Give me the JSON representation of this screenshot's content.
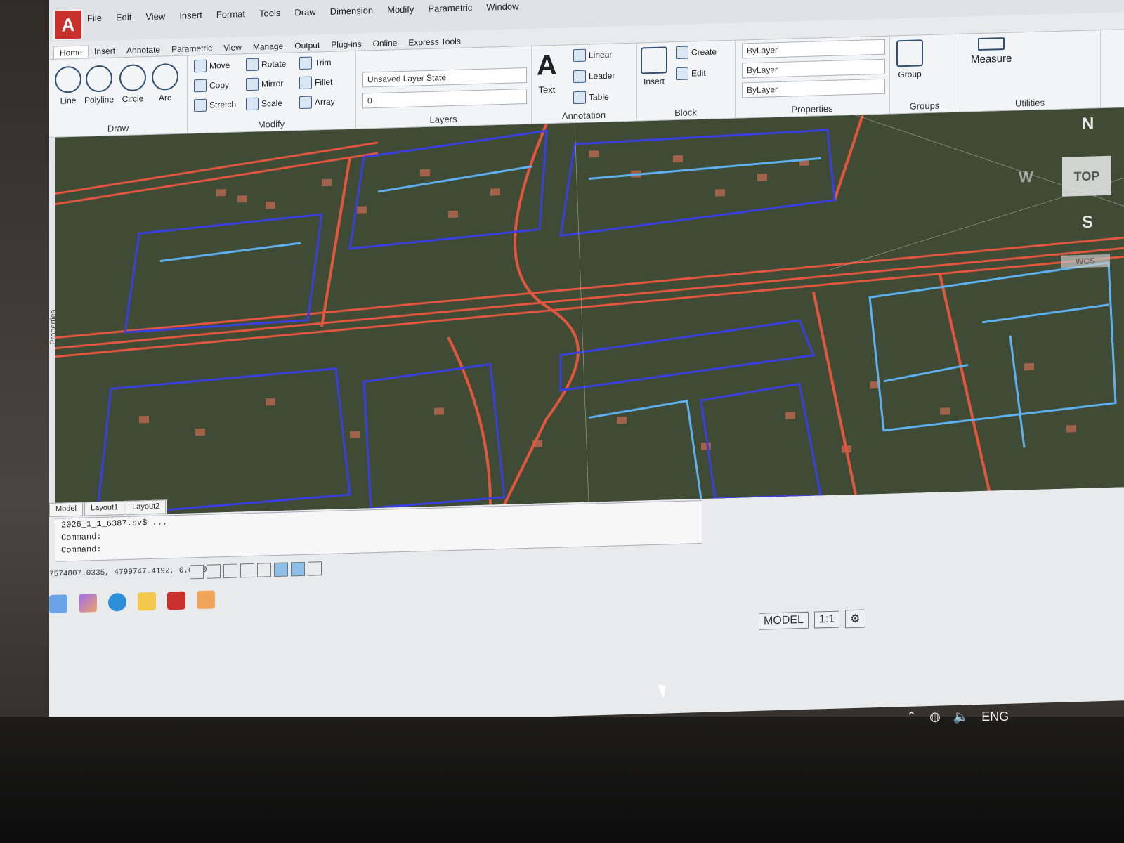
{
  "app": {
    "logo": "A",
    "file": "2026_1_1_6387.sv$ ..."
  },
  "menu": [
    "File",
    "Edit",
    "View",
    "Insert",
    "Format",
    "Tools",
    "Draw",
    "Dimension",
    "Modify",
    "Parametric",
    "Window"
  ],
  "menu2": [
    "Parametric",
    "View",
    "Manage",
    "Output",
    "Plug-ins",
    "Online",
    "Express Tools"
  ],
  "ribbon_tabs": [
    "Home",
    "Insert",
    "Annotate",
    "Parametric",
    "View",
    "Manage",
    "Output",
    "Plug-ins",
    "Online",
    "Express Tools"
  ],
  "draw": {
    "title": "Draw",
    "tools": [
      "Line",
      "Polyline",
      "Circle",
      "Arc"
    ]
  },
  "modify": {
    "title": "Modify",
    "tools": [
      "Move",
      "Rotate",
      "Trim",
      "Copy",
      "Mirror",
      "Fillet",
      "Stretch",
      "Scale",
      "Array"
    ]
  },
  "layers": {
    "title": "Layers",
    "layer_state": "Unsaved Layer State",
    "current_layer": "0"
  },
  "annotation": {
    "title": "Annotation",
    "text": "Text",
    "linear": "Linear",
    "leader": "Leader",
    "table": "Table"
  },
  "block": {
    "title": "Block",
    "insert": "Insert",
    "create": "Create",
    "edit": "Edit"
  },
  "properties": {
    "title": "Properties",
    "color": "ByLayer",
    "linetype": "ByLayer",
    "lineweight": "ByLayer"
  },
  "groups": {
    "title": "Groups",
    "group": "Group"
  },
  "utilities": {
    "title": "Utilities",
    "measure": "Measure"
  },
  "viewcube": {
    "n": "N",
    "top": "TOP",
    "w": "W",
    "s": "S",
    "wcs": "WCS"
  },
  "side_panel": "Properties",
  "layout_tabs": [
    "Model",
    "Layout1",
    "Layout2"
  ],
  "command": {
    "history": "2026_1_1_6387.sv$ ...",
    "line1": "Command:",
    "line2": "Command:"
  },
  "coords": "7574807.0335, 4799747.4192, 0.0000",
  "status": {
    "model": "MODEL",
    "scale": "1:1"
  },
  "systray": {
    "lang": "ENG"
  },
  "colors": {
    "road_red": "#e0563f",
    "parcel_blue": "#3a3fe0",
    "lightblue": "#5eb1f0",
    "ground": "#2b3325"
  }
}
